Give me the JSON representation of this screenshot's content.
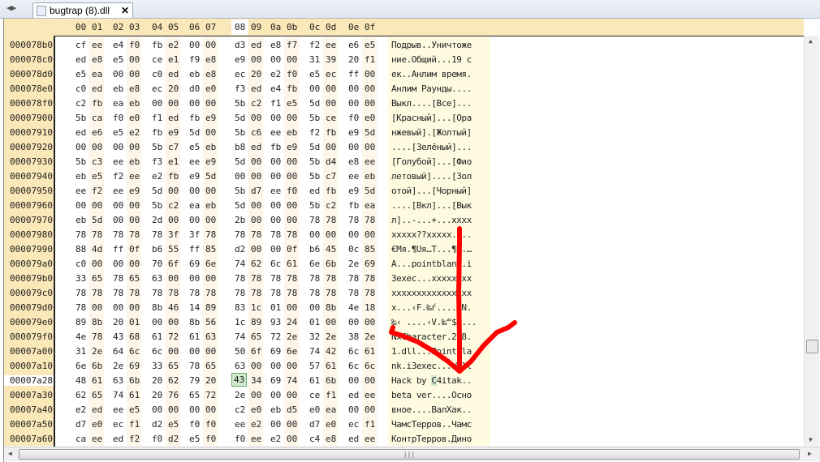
{
  "tab": {
    "title": "bugtrap (8).dll",
    "icon": "dll-file-icon"
  },
  "header": [
    "00",
    "01",
    "02",
    "03",
    "04",
    "05",
    "06",
    "07",
    "08",
    "09",
    "0a",
    "0b",
    "0c",
    "0d",
    "0e",
    "0f"
  ],
  "selected_column": "08",
  "current_row": "00007a28",
  "selected_ascii_char": "C",
  "rows": [
    {
      "addr": "000078b0",
      "hex": [
        "cf",
        "ee",
        "e4",
        "f0",
        "fb",
        "e2",
        "00",
        "00",
        "d3",
        "ed",
        "e8",
        "f7",
        "f2",
        "ee",
        "e6",
        "e5"
      ],
      "ascii": "Подрыв..Уничтоже"
    },
    {
      "addr": "000078c0",
      "hex": [
        "ed",
        "e8",
        "e5",
        "00",
        "ce",
        "e1",
        "f9",
        "e8",
        "e9",
        "00",
        "00",
        "00",
        "31",
        "39",
        "20",
        "f1"
      ],
      "ascii": "ние.Общий...19 с"
    },
    {
      "addr": "000078d0",
      "hex": [
        "e5",
        "ea",
        "00",
        "00",
        "c0",
        "ed",
        "eb",
        "e8",
        "ec",
        "20",
        "e2",
        "f0",
        "e5",
        "ec",
        "ff",
        "00"
      ],
      "ascii": "ек..Анлим время."
    },
    {
      "addr": "000078e0",
      "hex": [
        "c0",
        "ed",
        "eb",
        "e8",
        "ec",
        "20",
        "d0",
        "e0",
        "f3",
        "ed",
        "e4",
        "fb",
        "00",
        "00",
        "00",
        "00"
      ],
      "ascii": "Анлим Раунды...."
    },
    {
      "addr": "000078f0",
      "hex": [
        "c2",
        "fb",
        "ea",
        "eb",
        "00",
        "00",
        "00",
        "00",
        "5b",
        "c2",
        "f1",
        "e5",
        "5d",
        "00",
        "00",
        "00"
      ],
      "ascii": "Выкл....[Все]..."
    },
    {
      "addr": "00007900",
      "hex": [
        "5b",
        "ca",
        "f0",
        "e0",
        "f1",
        "ed",
        "fb",
        "e9",
        "5d",
        "00",
        "00",
        "00",
        "5b",
        "ce",
        "f0",
        "e0"
      ],
      "ascii": "[Красный]...[Ора"
    },
    {
      "addr": "00007910",
      "hex": [
        "ed",
        "e6",
        "e5",
        "e2",
        "fb",
        "e9",
        "5d",
        "00",
        "5b",
        "c6",
        "ee",
        "eb",
        "f2",
        "fb",
        "e9",
        "5d"
      ],
      "ascii": "нжевый].[Жолтый]"
    },
    {
      "addr": "00007920",
      "hex": [
        "00",
        "00",
        "00",
        "00",
        "5b",
        "c7",
        "e5",
        "eb",
        "b8",
        "ed",
        "fb",
        "e9",
        "5d",
        "00",
        "00",
        "00"
      ],
      "ascii": "....[Зелёный]..."
    },
    {
      "addr": "00007930",
      "hex": [
        "5b",
        "c3",
        "ee",
        "eb",
        "f3",
        "e1",
        "ee",
        "e9",
        "5d",
        "00",
        "00",
        "00",
        "5b",
        "d4",
        "e8",
        "ee"
      ],
      "ascii": "[Голубой]...[Фио"
    },
    {
      "addr": "00007940",
      "hex": [
        "eb",
        "e5",
        "f2",
        "ee",
        "e2",
        "fb",
        "e9",
        "5d",
        "00",
        "00",
        "00",
        "00",
        "5b",
        "c7",
        "ee",
        "eb"
      ],
      "ascii": "летовый]....[Зол"
    },
    {
      "addr": "00007950",
      "hex": [
        "ee",
        "f2",
        "ee",
        "e9",
        "5d",
        "00",
        "00",
        "00",
        "5b",
        "d7",
        "ee",
        "f0",
        "ed",
        "fb",
        "e9",
        "5d"
      ],
      "ascii": "отой]...[Чорный]"
    },
    {
      "addr": "00007960",
      "hex": [
        "00",
        "00",
        "00",
        "00",
        "5b",
        "c2",
        "ea",
        "eb",
        "5d",
        "00",
        "00",
        "00",
        "5b",
        "c2",
        "fb",
        "ea"
      ],
      "ascii": "....[Вкл]...[Вык"
    },
    {
      "addr": "00007970",
      "hex": [
        "eb",
        "5d",
        "00",
        "00",
        "2d",
        "00",
        "00",
        "00",
        "2b",
        "00",
        "00",
        "00",
        "78",
        "78",
        "78",
        "78"
      ],
      "ascii": "л]..-...+...xxxx"
    },
    {
      "addr": "00007980",
      "hex": [
        "78",
        "78",
        "78",
        "78",
        "78",
        "3f",
        "3f",
        "78",
        "78",
        "78",
        "78",
        "78",
        "00",
        "00",
        "00",
        "00"
      ],
      "ascii": "xxxxx??xxxxx...."
    },
    {
      "addr": "00007990",
      "hex": [
        "88",
        "4d",
        "ff",
        "0f",
        "b6",
        "55",
        "ff",
        "85",
        "d2",
        "00",
        "00",
        "0f",
        "b6",
        "45",
        "0c",
        "85"
      ],
      "ascii": "€Mя.¶Uя…Т...¶E.…"
    },
    {
      "addr": "000079a0",
      "hex": [
        "c0",
        "00",
        "00",
        "00",
        "70",
        "6f",
        "69",
        "6e",
        "74",
        "62",
        "6c",
        "61",
        "6e",
        "6b",
        "2e",
        "69"
      ],
      "ascii": "А...pointblank.i"
    },
    {
      "addr": "000079b0",
      "hex": [
        "33",
        "65",
        "78",
        "65",
        "63",
        "00",
        "00",
        "00",
        "78",
        "78",
        "78",
        "78",
        "78",
        "78",
        "78",
        "78"
      ],
      "ascii": "3exec...xxxxxxxx"
    },
    {
      "addr": "000079c0",
      "hex": [
        "78",
        "78",
        "78",
        "78",
        "78",
        "78",
        "78",
        "78",
        "78",
        "78",
        "78",
        "78",
        "78",
        "78",
        "78",
        "78"
      ],
      "ascii": "xxxxxxxxxxxxxxxx"
    },
    {
      "addr": "000079d0",
      "hex": [
        "78",
        "00",
        "00",
        "00",
        "8b",
        "46",
        "14",
        "89",
        "83",
        "1c",
        "01",
        "00",
        "00",
        "8b",
        "4e",
        "18"
      ],
      "ascii": "x...‹F.‰ѓ....‹N."
    },
    {
      "addr": "000079e0",
      "hex": [
        "89",
        "8b",
        "20",
        "01",
        "00",
        "00",
        "8b",
        "56",
        "1c",
        "89",
        "93",
        "24",
        "01",
        "00",
        "00",
        "00"
      ],
      "ascii": "‰‹ ....‹V.‰“$...."
    },
    {
      "addr": "000079f0",
      "hex": [
        "4e",
        "78",
        "43",
        "68",
        "61",
        "72",
        "61",
        "63",
        "74",
        "65",
        "72",
        "2e",
        "32",
        "2e",
        "38",
        "2e"
      ],
      "ascii": "NxCharacter.2.8."
    },
    {
      "addr": "00007a00",
      "hex": [
        "31",
        "2e",
        "64",
        "6c",
        "6c",
        "00",
        "00",
        "00",
        "50",
        "6f",
        "69",
        "6e",
        "74",
        "42",
        "6c",
        "61"
      ],
      "ascii": "1.dll...PointBla"
    },
    {
      "addr": "00007a10",
      "hex": [
        "6e",
        "6b",
        "2e",
        "69",
        "33",
        "65",
        "78",
        "65",
        "63",
        "00",
        "00",
        "00",
        "57",
        "61",
        "6c",
        "6c"
      ],
      "ascii": "nk.i3exec...Wall"
    },
    {
      "addr": "00007a28",
      "hex": [
        "48",
        "61",
        "63",
        "6b",
        "20",
        "62",
        "79",
        "20",
        "43",
        "34",
        "69",
        "74",
        "61",
        "6b",
        "00",
        "00"
      ],
      "ascii": "Hack by C4itak.."
    },
    {
      "addr": "00007a30",
      "hex": [
        "62",
        "65",
        "74",
        "61",
        "20",
        "76",
        "65",
        "72",
        "2e",
        "00",
        "00",
        "00",
        "ce",
        "f1",
        "ed",
        "ee"
      ],
      "ascii": "beta ver....Осно"
    },
    {
      "addr": "00007a40",
      "hex": [
        "e2",
        "ed",
        "ee",
        "e5",
        "00",
        "00",
        "00",
        "00",
        "c2",
        "e0",
        "eb",
        "d5",
        "e0",
        "ea",
        "00",
        "00"
      ],
      "ascii": "вное....ВалХак.."
    },
    {
      "addr": "00007a50",
      "hex": [
        "d7",
        "e0",
        "ec",
        "f1",
        "d2",
        "e5",
        "f0",
        "f0",
        "ee",
        "e2",
        "00",
        "00",
        "d7",
        "e0",
        "ec",
        "f1"
      ],
      "ascii": "ЧамсТерров..Чамс"
    },
    {
      "addr": "00007a60",
      "hex": [
        "ca",
        "ee",
        "ed",
        "f2",
        "f0",
        "d2",
        "e5",
        "f0",
        "f0",
        "ee",
        "e2",
        "00",
        "c4",
        "e8",
        "ed",
        "ee"
      ],
      "ascii": "КонтрТерров.Дино"
    }
  ],
  "colors": {
    "address_bg": "#fbe8b8",
    "ascii_bg": "#fffbe0",
    "selection": "#cfe8cf",
    "annotation": "#ff0000"
  }
}
